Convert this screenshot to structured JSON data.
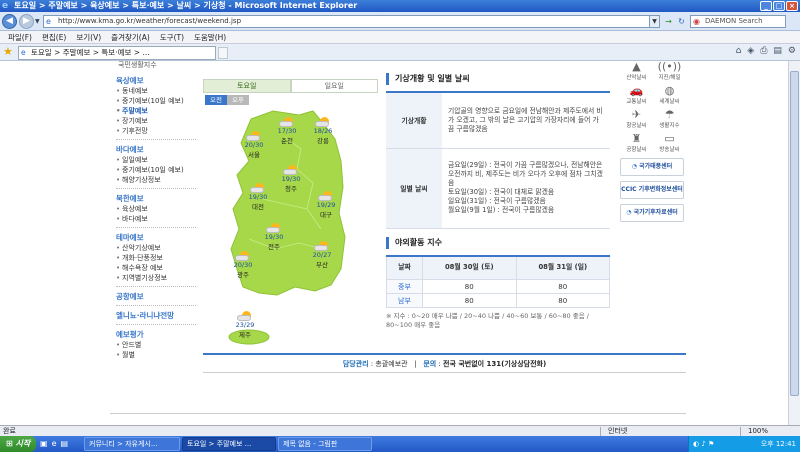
{
  "window": {
    "title": "토요일 > 주말예보 > 육상예보 > 특보·예보 > 날씨 > 기상청 - Microsoft Internet Explorer"
  },
  "address": {
    "url": "http://www.kma.go.kr/weather/forecast/weekend.jsp",
    "search_placeholder": "DAEMON Search"
  },
  "menu": [
    "파일(F)",
    "편집(E)",
    "보기(V)",
    "즐겨찾기(A)",
    "도구(T)",
    "도움말(H)"
  ],
  "favorites": {
    "tab_title": "토요일 > 주말예보 > 특보·예보 > ..."
  },
  "sidebar": {
    "top_item": "국민생활지수",
    "sections": [
      {
        "head": "육상예보",
        "items": [
          "동네예보",
          "중기예보(10일 예보)",
          "주말예보",
          "장기예보",
          "기후전망"
        ]
      },
      {
        "head": "바다예보",
        "items": [
          "일일예보",
          "중기예보(10일 예보)",
          "해양기상정보"
        ]
      },
      {
        "head": "북한예보",
        "items": [
          "육상예보",
          "바다예보"
        ]
      },
      {
        "head": "테마예보",
        "items": [
          "산악기상예보",
          "개화·단풍정보",
          "해수욕장 예보",
          "지역별기상정보"
        ]
      },
      {
        "head": "공항예보",
        "items": []
      },
      {
        "head": "엘니뇨·라니냐전망",
        "items": []
      },
      {
        "head": "예보평가",
        "items": [
          "안드별",
          "월별"
        ]
      }
    ]
  },
  "map": {
    "tabs": [
      "토요일",
      "일요일"
    ],
    "ampm": [
      "오전",
      "오후"
    ],
    "cities": [
      {
        "name": "서울",
        "temp": "20/30"
      },
      {
        "name": "춘천",
        "temp": "17/30"
      },
      {
        "name": "강릉",
        "temp": "18/26"
      },
      {
        "name": "청주",
        "temp": "19/30"
      },
      {
        "name": "대전",
        "temp": "19/30"
      },
      {
        "name": "대구",
        "temp": "19/29"
      },
      {
        "name": "전주",
        "temp": "19/30"
      },
      {
        "name": "광주",
        "temp": "20/30"
      },
      {
        "name": "부산",
        "temp": "20/27"
      },
      {
        "name": "제주",
        "temp": "23/29"
      }
    ]
  },
  "overview": {
    "title": "기상개황 및 일별 날씨",
    "rows": [
      {
        "label": "기상개황",
        "text": "기압골의 영향으로 금요일에 전남해안과 제주도에서 비가 오겠고, 그 밖의 날은 고기압의 가장자리에 들어 가끔 구름많겠음"
      },
      {
        "label": "일별 날씨",
        "text": "금요일(29일) : 전국이 가끔 구름많겠으나, 전남해안은 오전까지 비, 제주도는 비가 오다가 오후에 점차 그치겠음\n토요일(30일) : 전국이 대체로 맑겠음\n일요일(31일) : 전국이 구름많겠음\n월요일(9월 1일) : 전국이 구름많겠음"
      }
    ]
  },
  "activity": {
    "title": "야외활동 지수",
    "headers": [
      "날짜",
      "08월 30일 (토)",
      "08월 31일 (일)"
    ],
    "rows": [
      {
        "region": "중부",
        "sat": "80",
        "sun": "80"
      },
      {
        "region": "남부",
        "sat": "80",
        "sun": "80"
      }
    ],
    "note": "※ 지수 : 0~20 매우 나쁨 / 20~40 나쁨 / 40~60 보통 / 60~80 좋음 / 80~100 매우 좋음"
  },
  "iconpanel": {
    "icons": [
      "산악날씨",
      "지진/해일",
      "교통날씨",
      "세계날씨",
      "항공날씨",
      "생활지수",
      "공항날씨",
      "방송날씨"
    ],
    "banners": [
      "국가태풍센터",
      "CCIC 기후변화정보센터",
      "국가기후자료센터"
    ]
  },
  "footer": {
    "dept_label": "담당관리",
    "dept": "총괄예보관",
    "contact_label": "문의",
    "contact": "전국 국번없이 131(기상상담전화)"
  },
  "status": {
    "left": "완료",
    "zone": "인터넷",
    "zoom": "100%"
  },
  "taskbar": {
    "start": "시작",
    "tasks": [
      "커뮤니티 > 자유게시...",
      "토요일 > 주말예보 ...",
      "제목 없음 - 그림판"
    ],
    "clock": "오후 12:41"
  }
}
